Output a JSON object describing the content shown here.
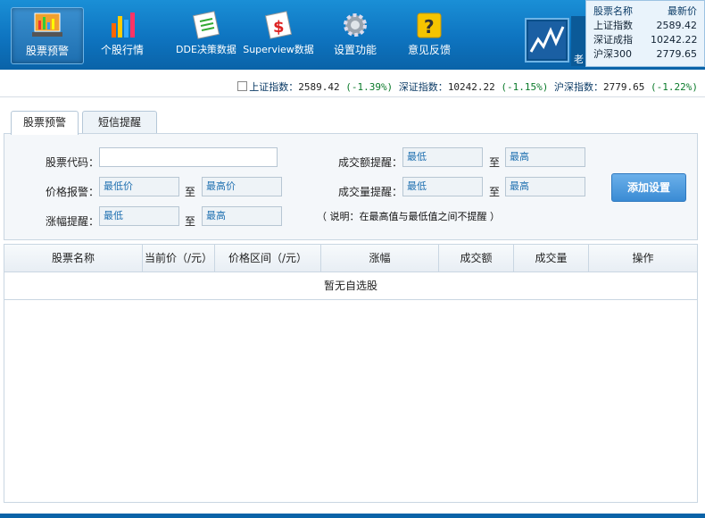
{
  "toolbar": {
    "items": [
      {
        "label": "股票预警",
        "icon": "laptop-chart-icon",
        "active": true
      },
      {
        "label": "个股行情",
        "icon": "bar-chart-icon"
      },
      {
        "label": "DDE决策数据",
        "icon": "document-icon"
      },
      {
        "label": "Superview数据",
        "icon": "dollar-document-icon"
      },
      {
        "label": "设置功能",
        "icon": "gear-icon"
      },
      {
        "label": "意见反馈",
        "icon": "question-folder-icon"
      }
    ],
    "logo_text": "老"
  },
  "index_panel": {
    "header": {
      "name": "股票名称",
      "price": "最新价"
    },
    "rows": [
      {
        "name": "上证指数",
        "price": "2589.42"
      },
      {
        "name": "深证成指",
        "price": "10242.22"
      },
      {
        "name": "沪深300",
        "price": "2779.65"
      }
    ]
  },
  "ticker": {
    "items": [
      {
        "label": "上证指数：",
        "value": "2589.42",
        "change": "(-1.39%)"
      },
      {
        "label": "深证指数：",
        "value": "10242.22",
        "change": "(-1.15%)"
      },
      {
        "label": "沪深指数：",
        "value": "2779.65",
        "change": "(-1.22%)"
      }
    ]
  },
  "tabs": [
    {
      "label": "股票预警",
      "active": true
    },
    {
      "label": "短信提醒"
    }
  ],
  "form": {
    "stock_code_label": "股票代码：",
    "stock_code_value": "",
    "price_alert_label": "价格报警：",
    "price_min": "最低价",
    "price_max": "最高价",
    "change_alert_label": "涨幅提醒：",
    "change_min": "最低",
    "change_max": "最高",
    "amount_alert_label": "成交额提醒：",
    "amount_min": "最低",
    "amount_max": "最高",
    "volume_alert_label": "成交量提醒：",
    "volume_min": "最低",
    "volume_max": "最高",
    "to": "至",
    "note": "（ 说明：在最高值与最低值之间不提醒 ）",
    "add_button": "添加设置"
  },
  "table": {
    "columns": [
      "股票名称",
      "当前价（/元）",
      "价格区间（/元）",
      "涨幅",
      "成交额",
      "成交量",
      "操作"
    ],
    "empty_text": "暂无自选股"
  },
  "colors": {
    "toolbar": "#0e74c0",
    "accent": "#3a8bd4",
    "ticker_value": "#0a7a2a"
  }
}
